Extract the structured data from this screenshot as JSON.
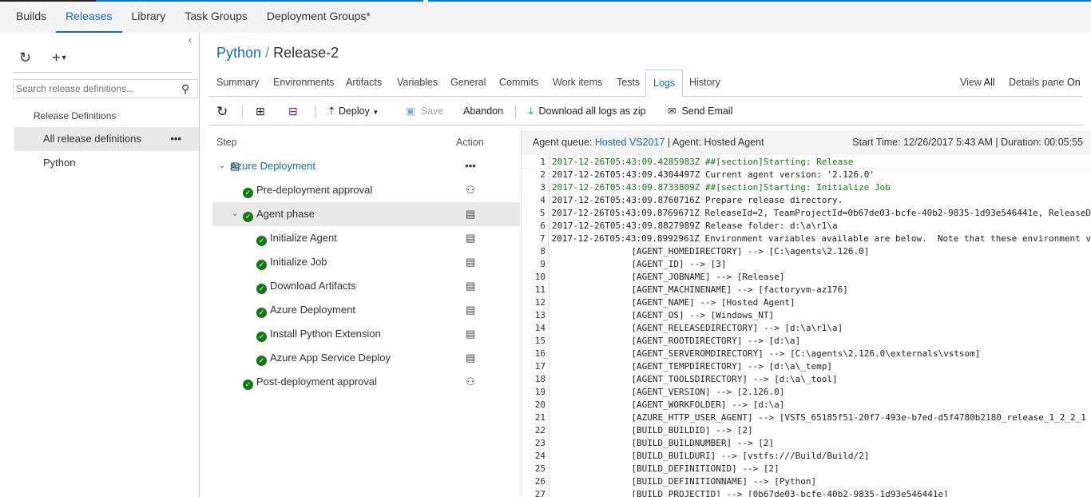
{
  "nav": {
    "tabs": [
      "Builds",
      "Releases",
      "Library",
      "Task Groups",
      "Deployment Groups*"
    ],
    "active": 1
  },
  "left": {
    "search_placeholder": "Search release definitions...",
    "section": "Release Definitions",
    "items": [
      "All release definitions",
      "Python"
    ],
    "more": "•••",
    "collapse": "‹"
  },
  "breadcrumb": {
    "parent": "Python",
    "sep": "/",
    "current": "Release-2"
  },
  "tabs": [
    "Summary",
    "Environments",
    "Artifacts",
    "Variables",
    "General",
    "Commits",
    "Work items",
    "Tests",
    "Logs",
    "History"
  ],
  "view": {
    "label": "View",
    "value": "All",
    "details_label": "Details pane",
    "details_value": "On"
  },
  "toolbar": {
    "deploy": "Deploy",
    "save": "Save",
    "abandon": "Abandon",
    "download": "Download all logs as zip",
    "email": "Send Email"
  },
  "steps": {
    "col_step": "Step",
    "col_action": "Action",
    "rows": [
      {
        "label": "Azure Deployment",
        "level": 0,
        "icon": "server-icon",
        "action": "•••"
      },
      {
        "label": "Pre-deployment approval",
        "level": 1,
        "action": "person-icon"
      },
      {
        "label": "Agent phase",
        "level": 1,
        "action": "log-icon",
        "expanded": true,
        "selected": true
      },
      {
        "label": "Initialize Agent",
        "level": 2,
        "action": "log-icon"
      },
      {
        "label": "Initialize Job",
        "level": 2,
        "action": "log-icon"
      },
      {
        "label": "Download Artifacts",
        "level": 2,
        "action": "log-icon"
      },
      {
        "label": "Azure Deployment",
        "level": 2,
        "action": "log-icon"
      },
      {
        "label": "Install Python Extension",
        "level": 2,
        "action": "log-icon"
      },
      {
        "label": "Azure App Service Deploy",
        "level": 2,
        "action": "log-icon"
      },
      {
        "label": "Post-deployment approval",
        "level": 1,
        "action": "person-icon"
      }
    ]
  },
  "log": {
    "queue_label": "Agent queue:",
    "queue": "Hosted VS2017",
    "agent": "| Agent: Hosted Agent",
    "start": "Start Time: 12/26/2017 5:43 AM | Duration: 00:05:55",
    "lines": [
      "2017-12-26T05:43:09.4285983Z ##[section]Starting: Release",
      "2017-12-26T05:43:09.4304497Z Current agent version: '2.126.0'",
      "2017-12-26T05:43:09.8733809Z ##[section]Starting: Initialize Job",
      "2017-12-26T05:43:09.8760716Z Prepare release directory.",
      "2017-12-26T05:43:09.8769671Z ReleaseId=2, TeamProjectId=0b67de03-bcfe-40b2-9835-1d93e546441e, ReleaseD",
      "2017-12-26T05:43:09.8827989Z Release folder: d:\\a\\r1\\a",
      "2017-12-26T05:43:09.8992961Z Environment variables available are below.  Note that these environment v",
      "               [AGENT_HOMEDIRECTORY] --> [C:\\agents\\2.126.0]",
      "               [AGENT_ID] --> [3]",
      "               [AGENT_JOBNAME] --> [Release]",
      "               [AGENT_MACHINENAME] --> [factoryvm-az176]",
      "               [AGENT_NAME] --> [Hosted Agent]",
      "               [AGENT_OS] --> [Windows_NT]",
      "               [AGENT_RELEASEDIRECTORY] --> [d:\\a\\r1\\a]",
      "               [AGENT_ROOTDIRECTORY] --> [d:\\a]",
      "               [AGENT_SERVEROMDIRECTORY] --> [C:\\agents\\2.126.0\\externals\\vstsom]",
      "               [AGENT_TEMPDIRECTORY] --> [d:\\a\\_temp]",
      "               [AGENT_TOOLSDIRECTORY] --> [d:\\a\\_tool]",
      "               [AGENT_VERSION] --> [2.126.0]",
      "               [AGENT_WORKFOLDER] --> [d:\\a]",
      "               [AZURE_HTTP_USER_AGENT] --> [VSTS_65185f51-20f7-493e-b7ed-d5f4780b2180_release_1_2_2_1",
      "               [BUILD_BUILDID] --> [2]",
      "               [BUILD_BUILDNUMBER] --> [2]",
      "               [BUILD_BUILDURI] --> [vstfs:///Build/Build/2]",
      "               [BUILD_DEFINITIONID] --> [2]",
      "               [BUILD_DEFINITIONNAME] --> [Python]",
      "               [BUILD_PROJECTID] --> [0b67de03-bcfe-40b2-9835-1d93e546441e]"
    ]
  },
  "colors": {
    "accent": "#106ebe",
    "success": "#107c10"
  }
}
